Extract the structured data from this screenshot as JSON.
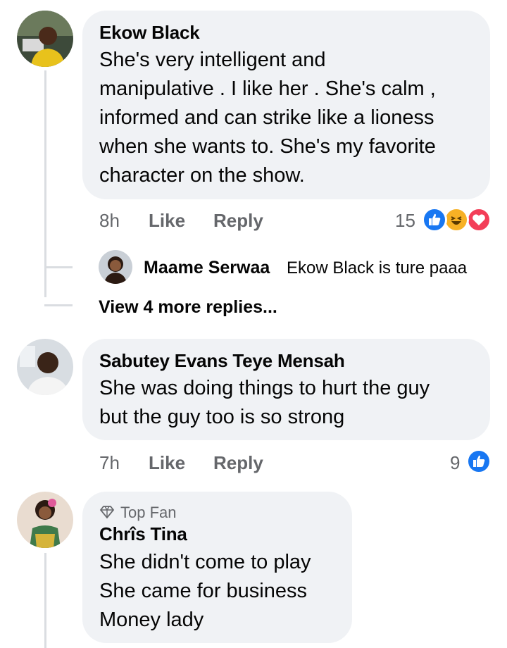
{
  "comments": [
    {
      "author": "Ekow Black",
      "text": "She's very intelligent and\nmanipulative . I like her . She's calm ,\ninformed and can strike like a lioness\nwhen she wants to. She's my favorite\ncharacter on the show.",
      "time": "8h",
      "like_label": "Like",
      "reply_label": "Reply",
      "reaction_count": "15",
      "reactions": [
        "like-icon",
        "haha-icon",
        "love-icon"
      ],
      "replies": [
        {
          "author": "Maame Serwaa",
          "text": "Ekow Black is ture paaa"
        }
      ],
      "more_replies_label": "View 4 more replies..."
    },
    {
      "author": "Sabutey Evans Teye Mensah",
      "text": "She was doing things to hurt the guy\nbut the guy too is so strong",
      "time": "7h",
      "like_label": "Like",
      "reply_label": "Reply",
      "reaction_count": "9",
      "reactions": [
        "like-icon"
      ]
    },
    {
      "badge": "Top Fan",
      "author": "Chrîs Tina",
      "text": "She didn't come to play\nShe came for business\nMoney lady"
    }
  ],
  "colors": {
    "bubble": "#f0f2f5",
    "meta_text": "#65676b",
    "like_blue": "#1877f2",
    "love_red": "#f33e58",
    "haha_yellow": "#f7b125"
  }
}
